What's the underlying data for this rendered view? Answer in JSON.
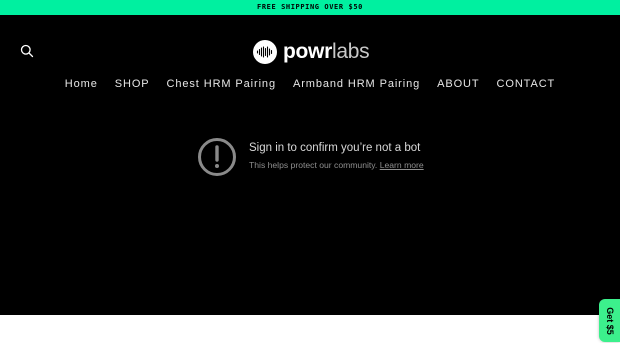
{
  "announcement": {
    "text": "FREE SHIPPING OVER $50"
  },
  "header": {
    "search_icon": "search-icon",
    "logo": {
      "bold": "powr",
      "thin": "labs"
    }
  },
  "nav": {
    "items": [
      {
        "label": "Home"
      },
      {
        "label": "SHOP"
      },
      {
        "label": "Chest HRM Pairing"
      },
      {
        "label": "Armband HRM Pairing"
      },
      {
        "label": "ABOUT"
      },
      {
        "label": "CONTACT"
      }
    ]
  },
  "notice": {
    "icon": "alert-circle-icon",
    "title": "Sign in to confirm you’re not a bot",
    "subtitle": "This helps protect our community.",
    "link": "Learn more"
  },
  "promo_tab": {
    "label": "Get $5"
  },
  "colors": {
    "announcement_bg": "#00f0a0",
    "page_bg": "#000000",
    "promo_bg": "#3cf08c"
  }
}
